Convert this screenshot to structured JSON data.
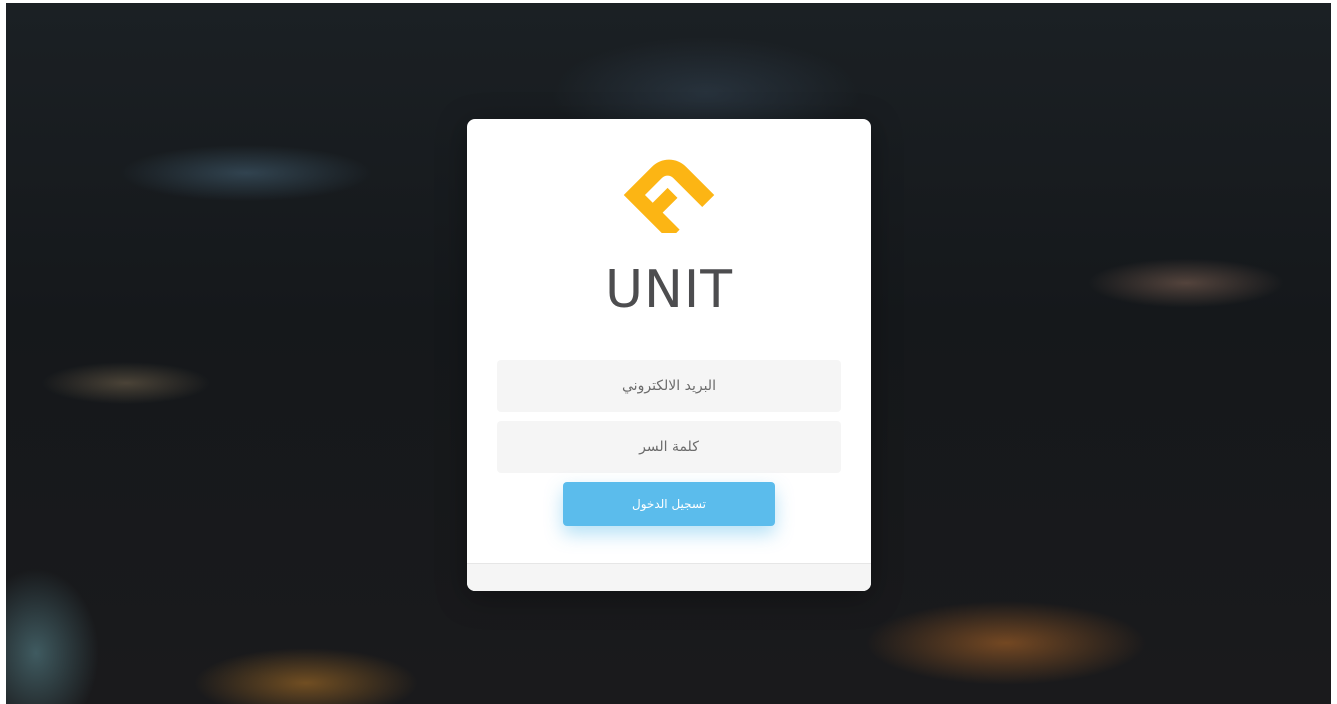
{
  "brand": {
    "name": "UNIT",
    "logo_color": "#fcb514",
    "text_color": "#4d4d4f"
  },
  "login_form": {
    "email_placeholder": "البريد الالكتروني",
    "email_value": "",
    "password_placeholder": "كلمة السر",
    "password_value": "",
    "submit_label": "تسجيل الدخول",
    "accent_color": "#5bbcec"
  }
}
